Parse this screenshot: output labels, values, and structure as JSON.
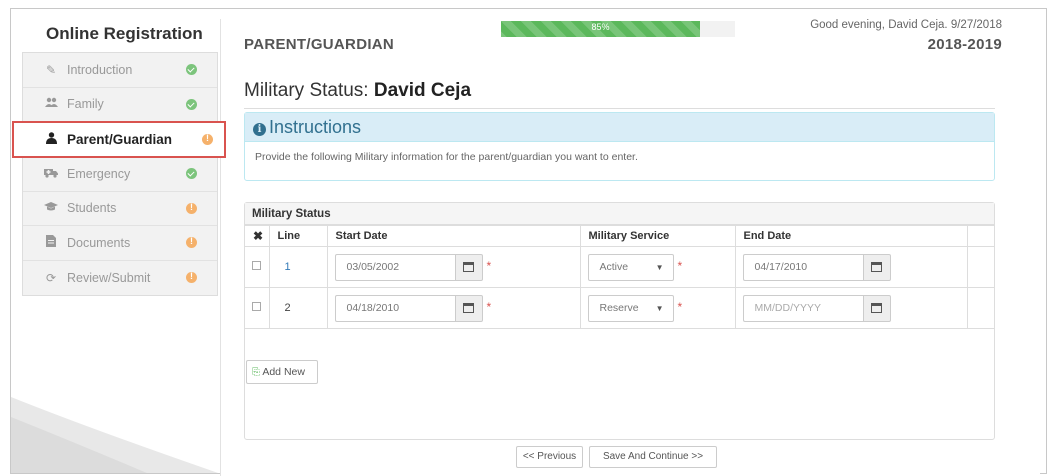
{
  "sidebar": {
    "title": "Online Registration",
    "items": [
      {
        "label": "Introduction",
        "icon": "pencil-icon",
        "status": "complete"
      },
      {
        "label": "Family",
        "icon": "users-icon",
        "status": "complete"
      },
      {
        "label": "Parent/Guardian",
        "icon": "user-icon",
        "status": "incomplete",
        "active": true
      },
      {
        "label": "Emergency",
        "icon": "ambulance-icon",
        "status": "complete"
      },
      {
        "label": "Students",
        "icon": "graduation-cap-icon",
        "status": "incomplete"
      },
      {
        "label": "Documents",
        "icon": "file-icon",
        "status": "incomplete"
      },
      {
        "label": "Review/Submit",
        "icon": "refresh-icon",
        "status": "incomplete"
      }
    ]
  },
  "header": {
    "greeting": "Good evening, David Ceja. 9/27/2018",
    "section": "PARENT/GUARDIAN",
    "year": "2018-2019",
    "progress_label": "85%",
    "progress_value": 0.85
  },
  "page": {
    "heading_prefix": "Military Status: ",
    "heading_name": "David Ceja"
  },
  "instructions": {
    "title": "Instructions",
    "text": "Provide the following Military information for the parent/guardian you want to enter."
  },
  "military": {
    "title": "Military Status",
    "columns": {
      "delete": "✖",
      "line": "Line",
      "start": "Start Date",
      "service": "Military Service",
      "end": "End Date"
    },
    "rows": [
      {
        "line": "1",
        "start": "03/05/2002",
        "service": "Active",
        "end": "04/17/2010"
      },
      {
        "line": "2",
        "start": "04/18/2010",
        "service": "Reserve",
        "end": ""
      }
    ],
    "end_placeholder": "MM/DD/YYYY",
    "add_label": "Add New"
  },
  "footer": {
    "previous": "<< Previous",
    "save": "Save And Continue >>"
  },
  "colors": {
    "success": "#5cb85c",
    "warning": "#f5b16b",
    "info": "#31708f",
    "active_border": "#d9534f"
  }
}
